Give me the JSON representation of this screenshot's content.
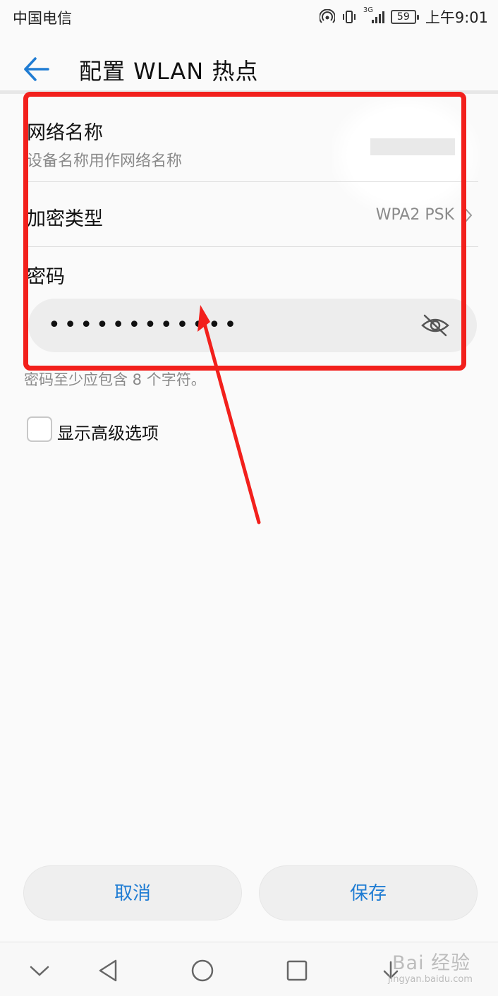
{
  "status_bar": {
    "carrier": "中国电信",
    "network_type": "3G",
    "battery": "59",
    "time": "上午9:01",
    "icons": [
      "hotspot-icon",
      "vibrate-icon",
      "signal-icon",
      "battery-icon"
    ]
  },
  "app_bar": {
    "title": "配置 WLAN 热点",
    "back_icon": "arrow-left-icon"
  },
  "form": {
    "network_name": {
      "label": "网络名称",
      "subtitle": "设备名称用作网络名称"
    },
    "encryption": {
      "label": "加密类型",
      "value": "WPA2 PSK",
      "icon": "chevron-right-icon"
    },
    "password": {
      "label": "密码",
      "value": "••••••••••••",
      "toggle_icon": "eye-off-icon",
      "hint": "密码至少应包含 8 个字符。"
    },
    "advanced": {
      "label": "显示高级选项",
      "checked": false
    }
  },
  "buttons": {
    "cancel": "取消",
    "save": "保存"
  },
  "nav_bar": {
    "icons": [
      "chevron-down-icon",
      "back-triangle-icon",
      "home-circle-icon",
      "recents-square-icon",
      "download-arrow-icon"
    ]
  },
  "watermark": {
    "main": "Bai 经验",
    "sub": "jingyan.baidu.com"
  },
  "colors": {
    "accent": "#1f7cd3",
    "annotation": "#f2201c",
    "background": "#fafafa"
  }
}
